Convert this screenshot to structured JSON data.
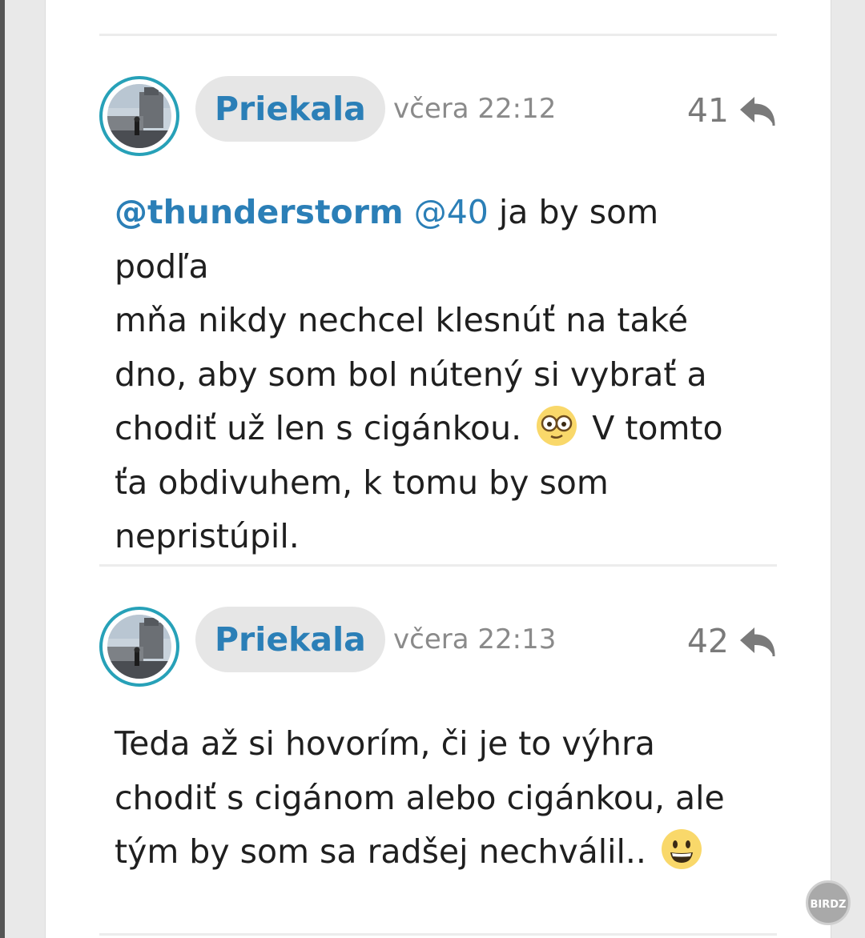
{
  "comments": [
    {
      "username": "Priekala",
      "timestamp": "včera 22:12",
      "number": "41",
      "avatar_icon": "user-avatar-photo",
      "mentions": [
        "@thunderstorm",
        "@40"
      ],
      "text_lines": [
        " ja by som podľa",
        "mňa nikdy nechcel klesnúť na také",
        "dno, aby som bol nútený si vybrať a",
        "chodiť už len s cigánkou. ",
        " V tomto",
        "ťa obdivuhem, k tomu by som",
        "nepristúpil."
      ],
      "emoji": "nerd-glasses-face"
    },
    {
      "username": "Priekala",
      "timestamp": "včera 22:13",
      "number": "42",
      "avatar_icon": "user-avatar-photo",
      "text_lines": [
        "Teda až si hovorím, či je to výhra",
        "chodiť s cigánom alebo cigánkou, ale",
        "tým by som sa radšej nechválil.. "
      ],
      "emoji": "grinning-face"
    }
  ],
  "watermark": "BIRDZ",
  "colors": {
    "accent": "#2b7fb7",
    "avatar_ring": "#27a1b8",
    "pill_bg": "#e6e6e6",
    "muted": "#8a8a8a"
  }
}
